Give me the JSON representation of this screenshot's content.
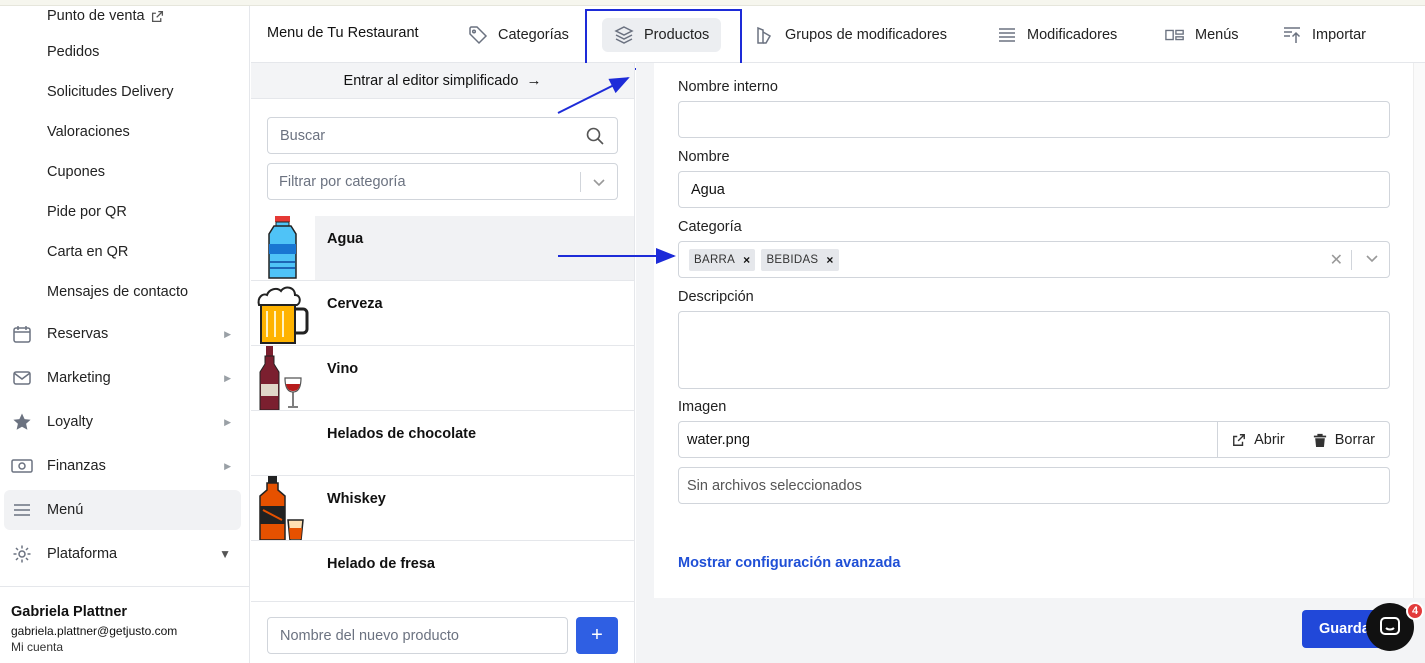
{
  "sidebar": {
    "sub_items": [
      {
        "label": "Punto de venta",
        "external": true
      },
      {
        "label": "Pedidos"
      },
      {
        "label": "Solicitudes Delivery"
      },
      {
        "label": "Valoraciones"
      },
      {
        "label": "Cupones"
      },
      {
        "label": "Pide por QR"
      },
      {
        "label": "Carta en QR"
      },
      {
        "label": "Mensajes de contacto"
      }
    ],
    "main_items": [
      {
        "label": "Reservas",
        "icon": "calendar-icon"
      },
      {
        "label": "Marketing",
        "icon": "mail-icon"
      },
      {
        "label": "Loyalty",
        "icon": "star-icon"
      },
      {
        "label": "Finanzas",
        "icon": "money-icon"
      },
      {
        "label": "Menú",
        "icon": "menu-lines-icon",
        "active": true
      },
      {
        "label": "Plataforma",
        "icon": "gear-icon"
      }
    ],
    "user": {
      "name": "Gabriela Plattner",
      "email": "gabriela.plattner@getjusto.com",
      "account_link": "Mi cuenta"
    }
  },
  "topnav": {
    "title": "Menu de Tu Restaurant",
    "tabs": [
      {
        "label": "Categorías",
        "icon": "tag-icon"
      },
      {
        "label": "Productos",
        "icon": "layers-icon",
        "active": true
      },
      {
        "label": "Grupos de modificadores",
        "icon": "shapes-icon"
      },
      {
        "label": "Modificadores",
        "icon": "list-icon"
      },
      {
        "label": "Menús",
        "icon": "columns-icon"
      },
      {
        "label": "Importar",
        "icon": "import-icon"
      }
    ]
  },
  "products_panel": {
    "simple_editor_label": "Entrar al editor simplificado",
    "search_placeholder": "Buscar",
    "filter_placeholder": "Filtrar por categoría",
    "products": [
      {
        "name": "Agua",
        "icon": "water-bottle-icon",
        "selected": true
      },
      {
        "name": "Cerveza",
        "icon": "beer-mug-icon"
      },
      {
        "name": "Vino",
        "icon": "wine-bottle-icon"
      },
      {
        "name": "Helados de chocolate",
        "icon": ""
      },
      {
        "name": "Whiskey",
        "icon": "whiskey-bottle-icon"
      },
      {
        "name": "Helado de fresa",
        "icon": ""
      }
    ],
    "new_product_placeholder": "Nombre del nuevo producto",
    "add_button": "+"
  },
  "form": {
    "internal_name_label": "Nombre interno",
    "internal_name_value": "",
    "name_label": "Nombre",
    "name_value": "Agua",
    "category_label": "Categoría",
    "categories": [
      "BARRA",
      "BEBIDAS"
    ],
    "description_label": "Descripción",
    "description_value": "",
    "image_label": "Imagen",
    "image_file": "water.png",
    "open_button": "Abrir",
    "delete_button": "Borrar",
    "file_input_text": "Sin archivos seleccionados",
    "advanced_link": "Mostrar configuración avanzada",
    "save_button": "Guardar"
  },
  "chat": {
    "badge_count": "4"
  },
  "colors": {
    "accent_blue": "#2148d9",
    "annotation_blue": "#1d2bd8",
    "badge_red": "#e23b3b"
  }
}
